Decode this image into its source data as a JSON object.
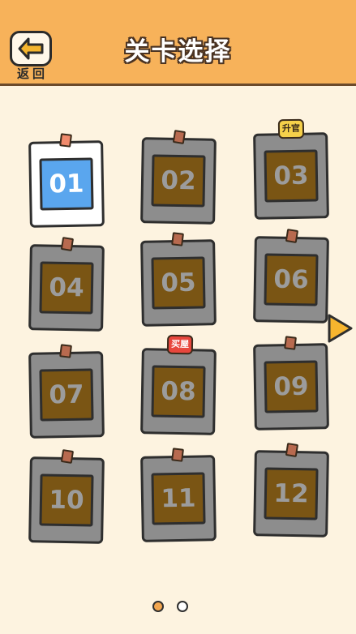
{
  "header": {
    "title": "关卡选择",
    "back_label": "返回",
    "bar_color": "#f7b25a"
  },
  "levels": [
    {
      "number": "01",
      "state": "unlocked",
      "badge": ""
    },
    {
      "number": "02",
      "state": "locked",
      "badge": ""
    },
    {
      "number": "03",
      "state": "locked",
      "badge": "升官"
    },
    {
      "number": "04",
      "state": "locked",
      "badge": ""
    },
    {
      "number": "05",
      "state": "locked",
      "badge": ""
    },
    {
      "number": "06",
      "state": "locked",
      "badge": ""
    },
    {
      "number": "07",
      "state": "locked",
      "badge": ""
    },
    {
      "number": "08",
      "state": "locked",
      "badge": "买屋"
    },
    {
      "number": "09",
      "state": "locked",
      "badge": ""
    },
    {
      "number": "10",
      "state": "locked",
      "badge": ""
    },
    {
      "number": "11",
      "state": "locked",
      "badge": ""
    },
    {
      "number": "12",
      "state": "locked",
      "badge": ""
    }
  ],
  "icons": {
    "back": "back-arrow-icon",
    "next": "next-page-arrow-icon"
  },
  "pagination": {
    "pages": 2,
    "current_page": 1
  },
  "colors": {
    "active_level": "#5aa6ee",
    "locked_level": "#7a5514",
    "background": "#fdf3e0"
  }
}
